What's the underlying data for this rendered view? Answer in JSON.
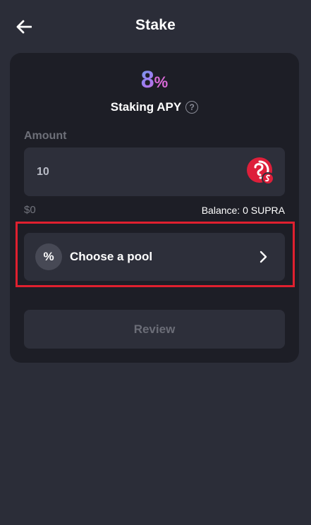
{
  "header": {
    "title": "Stake",
    "back_icon": "arrow-left-icon"
  },
  "apy": {
    "value": "8",
    "unit": "%",
    "label": "Staking APY",
    "help_icon": "question-circle-icon",
    "help_glyph": "?"
  },
  "amount": {
    "label": "Amount",
    "input_value": "10",
    "token_icon": "supra-token-icon",
    "usd_value": "$0",
    "balance": "Balance: 0 SUPRA"
  },
  "pool": {
    "icon": "percent-icon",
    "icon_glyph": "%",
    "label": "Choose a pool",
    "chevron": "chevron-right-icon"
  },
  "review": {
    "label": "Review"
  },
  "colors": {
    "background": "#2b2d38",
    "card": "#1d1e26",
    "field": "#2d2f3a",
    "highlight": "#e0202f",
    "token_red": "#dd1f3a"
  }
}
